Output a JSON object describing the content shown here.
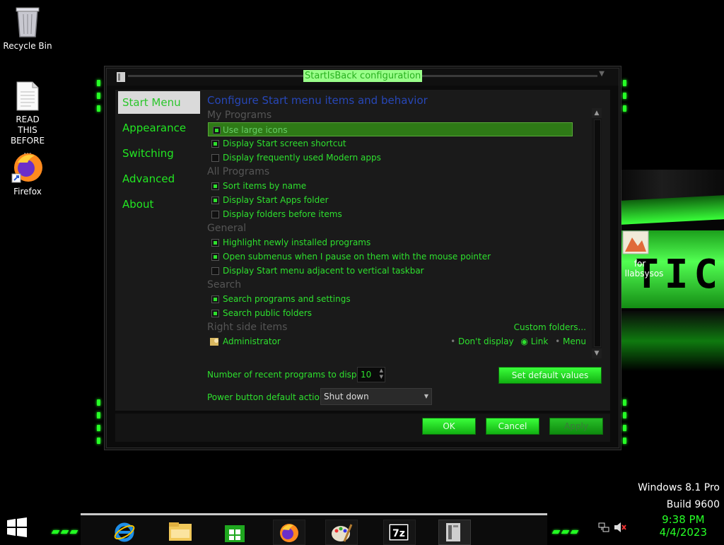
{
  "desktop": {
    "icons": [
      {
        "label": "Recycle Bin"
      },
      {
        "label": "READ THIS BEFORE ..."
      },
      {
        "label": "Firefox"
      }
    ],
    "partial_icon_label_1": "for",
    "partial_icon_label_2": "llabsysos",
    "wallpaper_text": "TIC",
    "watermark": {
      "line1": "Windows 8.1 Pro",
      "line2": "Build 9600"
    }
  },
  "dialog": {
    "title": "StartIsBack configuration",
    "nav": [
      "Start Menu",
      "Appearance",
      "Switching",
      "Advanced",
      "About"
    ],
    "heading": "Configure Start menu items and behavior",
    "sections": [
      {
        "title": "My Programs",
        "items": [
          {
            "label": "Use large icons",
            "checked": true,
            "highlighted": true
          },
          {
            "label": "Display Start screen shortcut",
            "checked": true
          },
          {
            "label": "Display frequently used Modern apps",
            "checked": false
          }
        ]
      },
      {
        "title": "All Programs",
        "items": [
          {
            "label": "Sort items by name",
            "checked": true
          },
          {
            "label": "Display Start Apps folder",
            "checked": true
          },
          {
            "label": "Display folders before items",
            "checked": false
          }
        ]
      },
      {
        "title": "General",
        "items": [
          {
            "label": "Highlight newly installed programs",
            "checked": true
          },
          {
            "label": "Open submenus when I pause on them with the mouse pointer",
            "checked": true
          },
          {
            "label": "Display Start menu adjacent to vertical taskbar",
            "checked": false
          }
        ]
      },
      {
        "title": "Search",
        "items": [
          {
            "label": "Search programs and settings",
            "checked": true
          },
          {
            "label": "Search public folders",
            "checked": true
          }
        ]
      }
    ],
    "right_side": {
      "title": "Right side items",
      "custom_folders": "Custom folders...",
      "item_label": "Administrator",
      "options": [
        "Don't display",
        "Link",
        "Menu"
      ],
      "selected": "Link"
    },
    "recent_label": "Number of recent programs to display:",
    "recent_value": "10",
    "set_default": "Set default values",
    "power_label": "Power button default action:",
    "power_value": "Shut down",
    "ok": "OK",
    "cancel": "Cancel",
    "apply": "Apply"
  },
  "taskbar": {
    "apps": [
      "internet-explorer-icon",
      "file-explorer-icon",
      "store-icon",
      "firefox-icon",
      "paint-icon",
      "7zip-icon",
      "startisback-config-icon"
    ],
    "tray": {
      "time": "9:38 PM",
      "date": "4/4/2023"
    }
  },
  "colors": {
    "accent": "#22ff22",
    "heading_blue": "#2747b8",
    "background": "#000000"
  }
}
